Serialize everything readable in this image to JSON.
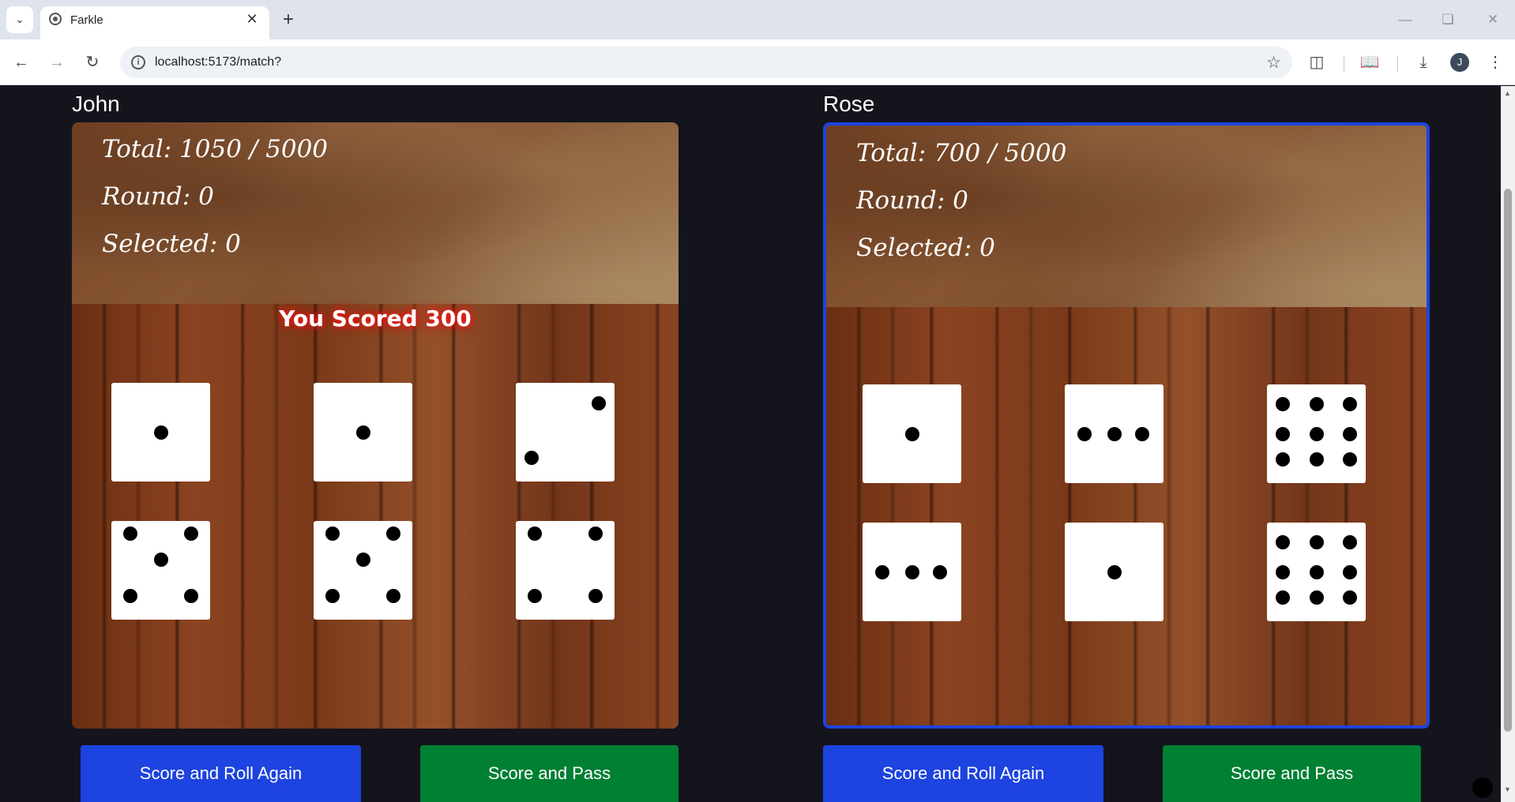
{
  "browser": {
    "tab_title": "Farkle",
    "url": "localhost:5173/match?",
    "profile_initial": "J"
  },
  "players": [
    {
      "name": "John",
      "total": "Total: 1050 / 5000",
      "round": "Round: 0",
      "selected": "Selected: 0",
      "message": "You Scored 300",
      "active": false,
      "dice": [
        1,
        1,
        2,
        5,
        5,
        4
      ],
      "buttons": {
        "roll_again": "Score and Roll Again",
        "pass": "Score and Pass"
      }
    },
    {
      "name": "Rose",
      "total": "Total: 700 / 5000",
      "round": "Round: 0",
      "selected": "Selected: 0",
      "message": "",
      "active": true,
      "dice": [
        1,
        3,
        9,
        3,
        1,
        9
      ],
      "buttons": {
        "roll_again": "Score and Roll Again",
        "pass": "Score and Pass"
      }
    }
  ],
  "colors": {
    "background": "#14141c",
    "active_border": "#1d43e0",
    "roll_again_button": "#1d43e0",
    "pass_button": "#008033",
    "score_glow": "#ff1a1a"
  }
}
